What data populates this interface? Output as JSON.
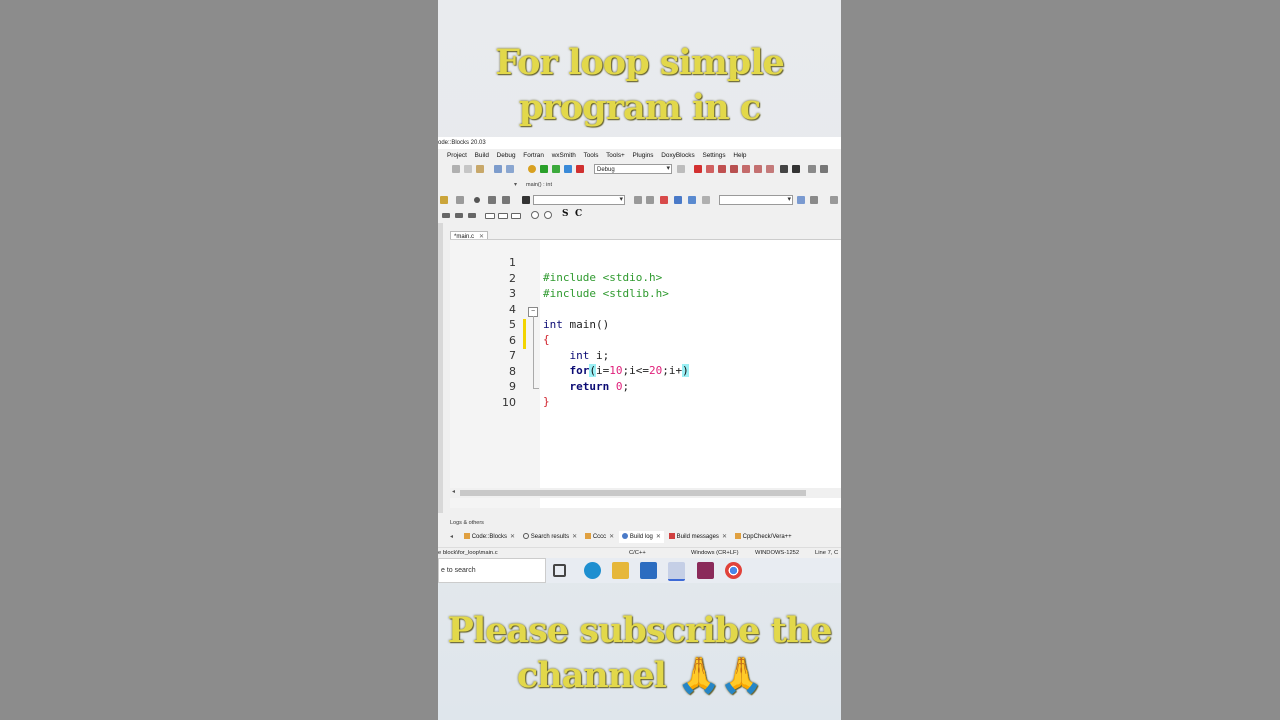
{
  "captions": {
    "top_line1": "For loop simple",
    "top_line2": "program in c",
    "bottom_line1": "Please subscribe the",
    "bottom_line2": "channel 🙏🙏"
  },
  "window": {
    "title": "ode::Blocks 20.03"
  },
  "menu": [
    "Project",
    "Build",
    "Debug",
    "Fortran",
    "wxSmith",
    "Tools",
    "Tools+",
    "Plugins",
    "DoxyBlocks",
    "Settings",
    "Help"
  ],
  "toolbar": {
    "build_target": "Debug",
    "scope": "main() : int"
  },
  "editor": {
    "tab_label": "*main.c",
    "lines": [
      {
        "n": "1",
        "text": "#include <stdio.h>"
      },
      {
        "n": "2",
        "text": "#include <stdlib.h>"
      },
      {
        "n": "3",
        "text": ""
      },
      {
        "n": "4",
        "text": "int main()"
      },
      {
        "n": "5",
        "text": "{"
      },
      {
        "n": "6",
        "text": "    int i;"
      },
      {
        "n": "7",
        "text": "    for(i=10;i<=20;i+)"
      },
      {
        "n": "8",
        "text": "    return 0;"
      },
      {
        "n": "9",
        "text": "}"
      },
      {
        "n": "10",
        "text": ""
      }
    ]
  },
  "logs": {
    "title": "Logs & others",
    "tabs": [
      "Code::Blocks",
      "Search results",
      "Cccc",
      "Build log",
      "Build messages",
      "CppCheck/Vera++"
    ]
  },
  "statusbar": {
    "path": "e block\\for_loop\\main.c",
    "language": "C/C++",
    "eol": "Windows (CR+LF)",
    "encoding": "WINDOWS-1252",
    "position": "Line 7, C"
  },
  "taskbar": {
    "search_placeholder": "e to search"
  },
  "colors": {
    "caption": "#e2d84a",
    "preprocessor": "#2f9a2f",
    "keyword": "#0b0b74",
    "number": "#e0207a",
    "brace_highlight": "#9bf0f5",
    "changed_marker": "#f2d400"
  }
}
